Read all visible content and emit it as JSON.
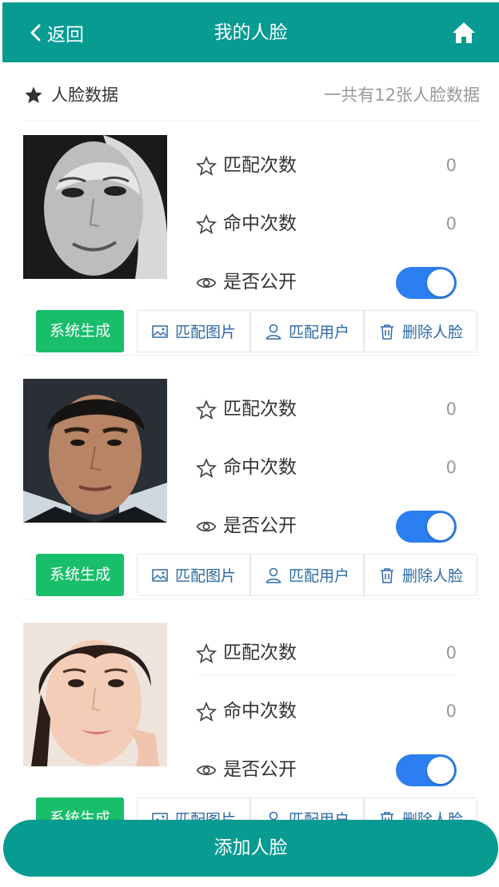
{
  "header": {
    "back_label": "返回",
    "title": "我的人脸",
    "back_icon": "chevron-left-icon",
    "home_icon": "home-icon"
  },
  "section": {
    "label": "人脸数据",
    "count_text": "一共有12张人脸数据",
    "icon": "star-icon"
  },
  "cards": [
    {
      "match_label": "匹配次数",
      "match_count": "0",
      "hit_label": "命中次数",
      "hit_count": "0",
      "public_label": "是否公开",
      "public_on": true,
      "source_label": "系统生成",
      "match_image_label": "匹配图片",
      "match_user_label": "匹配用户",
      "delete_label": "删除人脸"
    },
    {
      "match_label": "匹配次数",
      "match_count": "0",
      "hit_label": "命中次数",
      "hit_count": "0",
      "public_label": "是否公开",
      "public_on": true,
      "source_label": "系统生成",
      "match_image_label": "匹配图片",
      "match_user_label": "匹配用户",
      "delete_label": "删除人脸"
    },
    {
      "match_label": "匹配次数",
      "match_count": "0",
      "hit_label": "命中次数",
      "hit_count": "0",
      "public_label": "是否公开",
      "public_on": true,
      "source_label": "系统生成",
      "match_image_label": "匹配图片",
      "match_user_label": "匹配用户",
      "delete_label": "删除人脸"
    }
  ],
  "add_button_label": "添加人脸",
  "colors": {
    "primary": "#079b92",
    "toggle_on": "#2c7ff0",
    "source_badge": "#19be6b",
    "action_text": "#2d6aa6"
  }
}
